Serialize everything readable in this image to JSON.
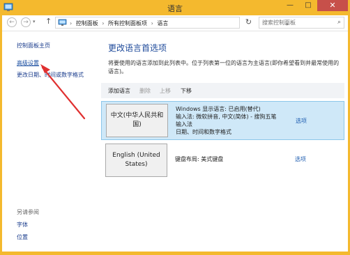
{
  "window": {
    "title": "语言",
    "minimize": "—",
    "maximize": "□",
    "close": "✕"
  },
  "nav": {
    "back": "←",
    "forward": "→",
    "dropdown": "▾",
    "up": "↑",
    "breadcrumbs": [
      "控制面板",
      "所有控制面板项",
      "语言"
    ],
    "separator": "›",
    "refresh": "↻",
    "search_placeholder": "搜索控制面板",
    "search_icon": "⌕"
  },
  "sidebar": {
    "home": "控制面板主页",
    "advanced": "高级设置",
    "date_formats": "更改日期、时间或数字格式",
    "see_also": "另请参阅",
    "fonts": "字体",
    "location": "位置"
  },
  "main": {
    "heading": "更改语言首选项",
    "description": "将要使用的语言添加到此列表中。位于列表第一位的语言为主语言(即你希望看到并最常使用的语言)。",
    "toolbar": {
      "add": "添加语言",
      "remove": "删除",
      "up": "上移",
      "down": "下移"
    },
    "languages": [
      {
        "name": "中文(中华人民共和国)",
        "lines": [
          "Windows 显示语言: 已启用(替代)",
          "输入法: 微软拼音, 中文(简体) - 搜狗五笔",
          "输入法",
          "日期、时间和数字格式"
        ],
        "options": "选项"
      },
      {
        "name": "English (United States)",
        "lines": [
          "键盘布局: 美式键盘"
        ],
        "options": "选项"
      }
    ]
  },
  "colors": {
    "frame": "#f4b92e",
    "close_button": "#c7504a",
    "selected_row": "#cfe8f8",
    "link": "#1e5db0",
    "annotation_arrow": "#e03030"
  }
}
